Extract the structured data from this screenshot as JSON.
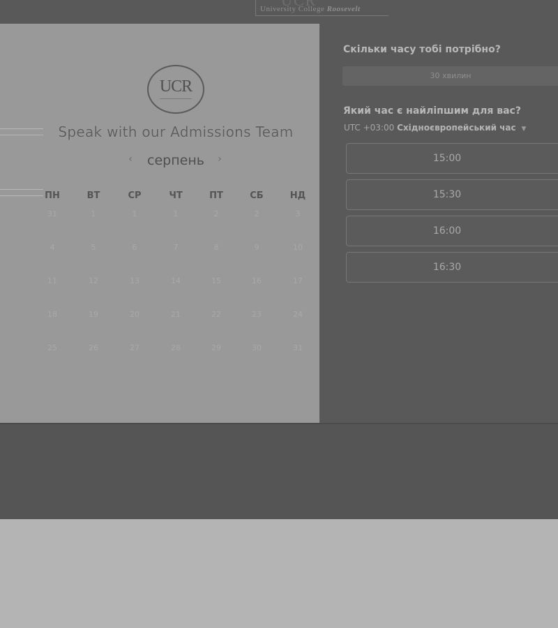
{
  "header": {
    "logo_mark": "UCR",
    "logo_text": "University College",
    "logo_text_italic": "Roosevelt"
  },
  "calendar": {
    "emblem_text": "UCR",
    "event_title": "Speak with our Admissions Team",
    "month": "серпень",
    "prev_icon": "‹",
    "next_icon": "›",
    "weekdays": [
      "ПН",
      "ВТ",
      "СР",
      "ЧТ",
      "ПТ",
      "СБ",
      "НД"
    ],
    "weeks": [
      [
        "31",
        "1",
        "1",
        "1",
        "2",
        "2",
        "3"
      ],
      [
        "4",
        "5",
        "6",
        "7",
        "8",
        "9",
        "10"
      ],
      [
        "11",
        "12",
        "13",
        "14",
        "15",
        "16",
        "17"
      ],
      [
        "18",
        "19",
        "20",
        "21",
        "22",
        "23",
        "24"
      ],
      [
        "25",
        "26",
        "27",
        "28",
        "29",
        "30",
        "31"
      ]
    ]
  },
  "booking": {
    "duration_question": "Скільки часу тобі потрібно?",
    "duration_value": "30 хвилин",
    "time_question": "Який час є найліпшим для вас?",
    "timezone_offset": "UTC +03:00",
    "timezone_name": "Східноєвропейський час",
    "slots": [
      "15:00",
      "15:30",
      "16:00",
      "16:30"
    ]
  }
}
